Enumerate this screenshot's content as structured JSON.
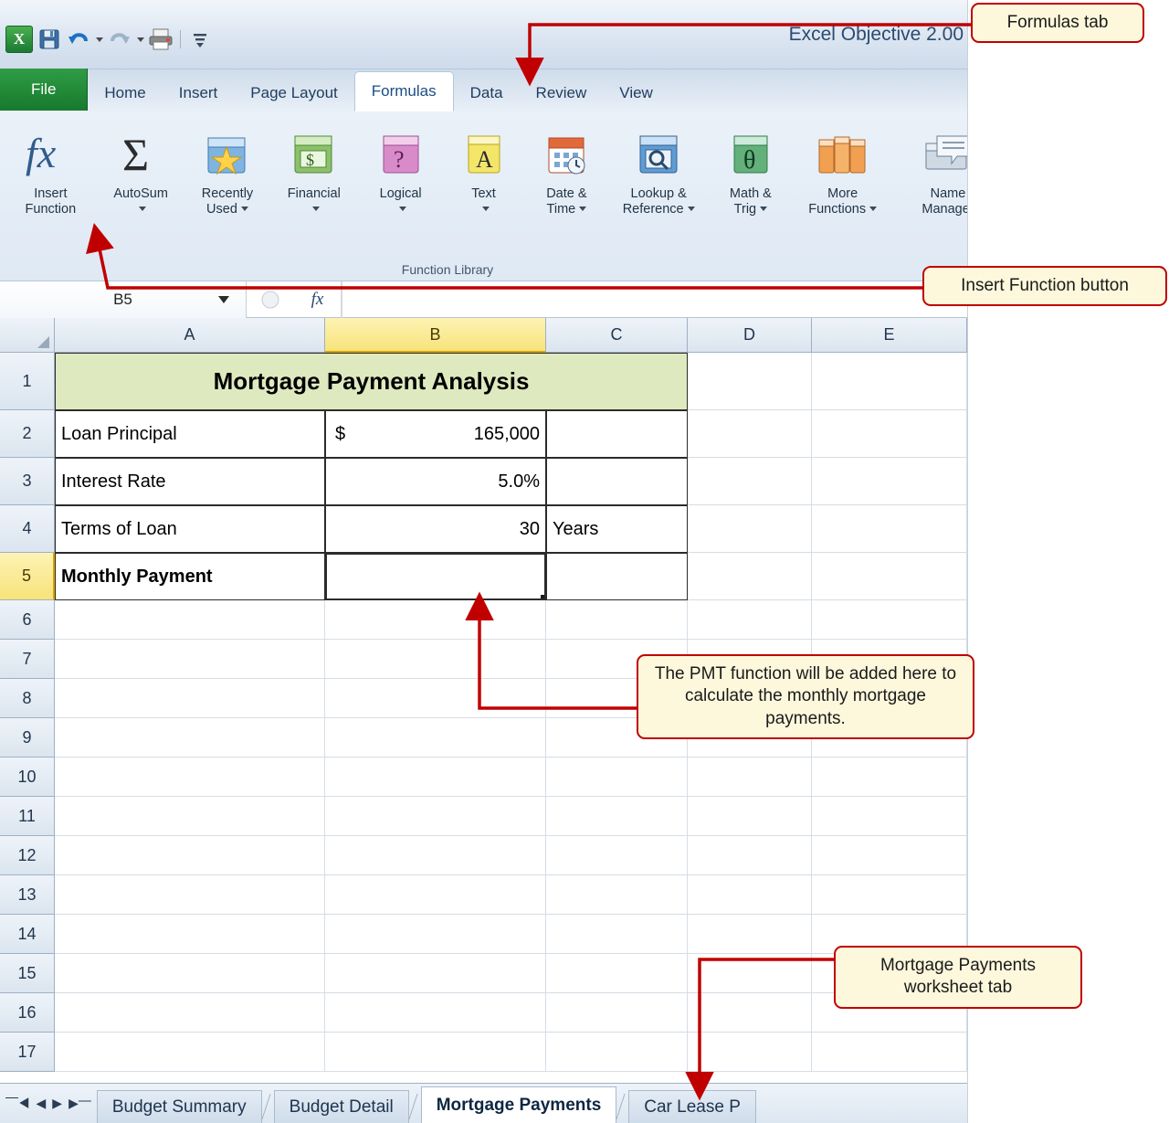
{
  "window": {
    "title": "Excel Objective 2.00",
    "quick_access": [
      "save-icon",
      "undo-icon",
      "redo-icon",
      "print-icon",
      "customize-icon"
    ]
  },
  "ribbon": {
    "tabs": [
      {
        "label": "File",
        "active": false
      },
      {
        "label": "Home",
        "active": false
      },
      {
        "label": "Insert",
        "active": false
      },
      {
        "label": "Page Layout",
        "active": false
      },
      {
        "label": "Formulas",
        "active": true
      },
      {
        "label": "Data",
        "active": false
      },
      {
        "label": "Review",
        "active": false
      },
      {
        "label": "View",
        "active": false
      }
    ],
    "group_label": "Function Library",
    "buttons": [
      {
        "line1": "Insert",
        "line2": "Function",
        "dropdown": false,
        "icon": "fx-icon"
      },
      {
        "line1": "AutoSum",
        "line2": "",
        "dropdown": true,
        "icon": "sigma-icon"
      },
      {
        "line1": "Recently",
        "line2": "Used",
        "dropdown": true,
        "icon": "recently-used-icon"
      },
      {
        "line1": "Financial",
        "line2": "",
        "dropdown": true,
        "icon": "financial-icon"
      },
      {
        "line1": "Logical",
        "line2": "",
        "dropdown": true,
        "icon": "logical-icon"
      },
      {
        "line1": "Text",
        "line2": "",
        "dropdown": true,
        "icon": "text-icon"
      },
      {
        "line1": "Date &",
        "line2": "Time",
        "dropdown": true,
        "icon": "date-time-icon"
      },
      {
        "line1": "Lookup &",
        "line2": "Reference",
        "dropdown": true,
        "icon": "lookup-reference-icon"
      },
      {
        "line1": "Math &",
        "line2": "Trig",
        "dropdown": true,
        "icon": "math-trig-icon"
      },
      {
        "line1": "More",
        "line2": "Functions",
        "dropdown": true,
        "icon": "more-functions-icon"
      },
      {
        "line1": "Name",
        "line2": "Manager",
        "dropdown": false,
        "icon": "name-manager-icon"
      }
    ]
  },
  "formula_bar": {
    "name_box": "B5",
    "fx_label": "fx",
    "formula_value": ""
  },
  "grid": {
    "columns": [
      "A",
      "B",
      "C",
      "D",
      "E"
    ],
    "selected_column": "B",
    "selected_row": "5",
    "rows": [
      "1",
      "2",
      "3",
      "4",
      "5",
      "6",
      "7",
      "8",
      "9",
      "10",
      "11",
      "12",
      "13",
      "14",
      "15",
      "16",
      "17"
    ],
    "cells": {
      "A1": "Mortgage Payment Analysis",
      "A2": "Loan Principal",
      "B2_currency": "$",
      "B2": "165,000",
      "A3": "Interest Rate",
      "B3": "5.0%",
      "A4": "Terms of Loan",
      "B4": "30",
      "C4": "Years",
      "A5": "Monthly Payment",
      "B5": ""
    }
  },
  "sheet_tabs": {
    "nav": [
      "first-sheet-icon",
      "prev-sheet-icon",
      "next-sheet-icon",
      "last-sheet-icon"
    ],
    "tabs": [
      {
        "label": "Budget Summary",
        "active": false
      },
      {
        "label": "Budget Detail",
        "active": false
      },
      {
        "label": "Mortgage Payments",
        "active": true
      },
      {
        "label": "Car Lease P",
        "active": false
      }
    ]
  },
  "callouts": {
    "formulas_tab": "Formulas tab",
    "insert_function": "Insert Function button",
    "pmt_note": "The PMT function will be added here to calculate the monthly mortgage payments.",
    "worksheet_tab_l1": "Mortgage Payments",
    "worksheet_tab_l2": "worksheet tab"
  },
  "colors": {
    "callout_border": "#c00000",
    "callout_fill": "#fdf8dc",
    "title_fill": "#dfe9bf",
    "selection": "#f7e37a"
  }
}
